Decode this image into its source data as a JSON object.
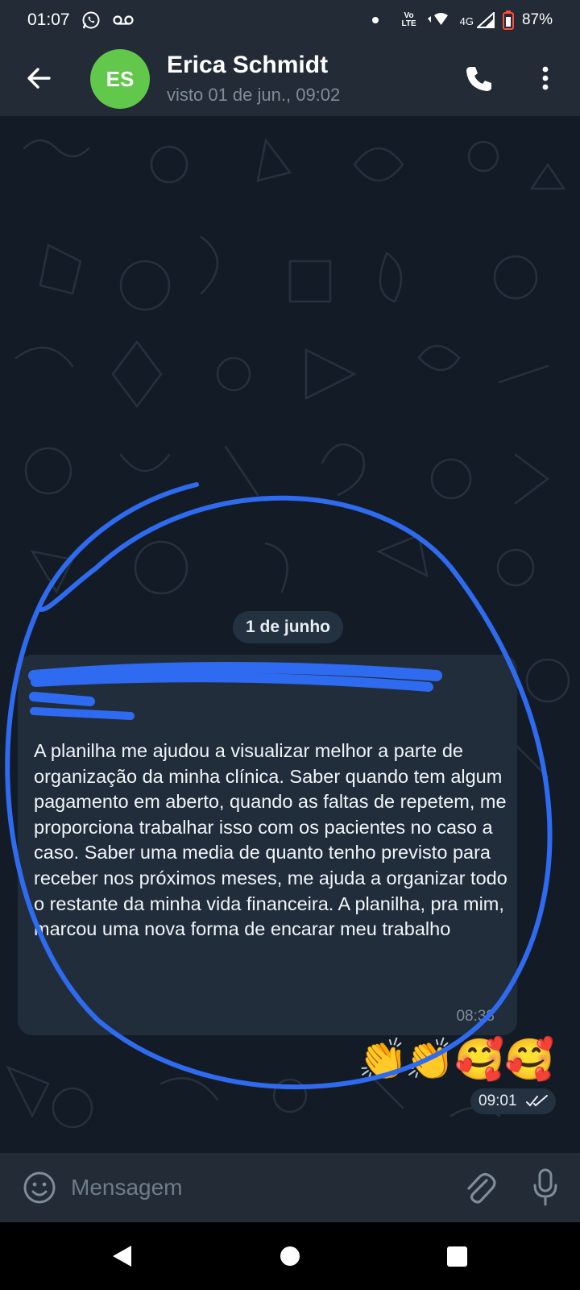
{
  "status_bar": {
    "time": "01:07",
    "lte_top": "Vo",
    "lte_bottom": "LTE",
    "network": "4G",
    "battery": "87%"
  },
  "header": {
    "avatar_initials": "ES",
    "avatar_color": "#62c84c",
    "contact_name": "Erica Schmidt",
    "last_seen": "visto 01 de jun., 09:02"
  },
  "chat": {
    "date_chip": "1 de junho",
    "incoming": {
      "text": "A planilha me ajudou a visualizar melhor a parte de organização da minha clínica. Saber quando tem algum pagamento em aberto, quando as faltas de repetem, me proporciona trabalhar isso com os pacientes no caso a caso. Saber uma media de quanto tenho previsto para receber nos próximos meses, me ajuda a organizar todo o restante da minha vida financeira. A planilha, pra mim, marcou uma nova forma de encarar meu trabalho",
      "time": "08:38"
    },
    "outgoing": {
      "emojis": [
        "👏",
        "👏",
        "🥰",
        "🥰"
      ],
      "time": "09:01",
      "status_icon": "double-check-icon"
    },
    "annotation_color": "#2f6bf0"
  },
  "composer": {
    "placeholder": "Mensagem"
  },
  "icons": [
    "back-arrow-icon",
    "phone-icon",
    "more-vert-icon",
    "emoji-icon",
    "paperclip-icon",
    "microphone-icon",
    "whatsapp-icon",
    "voicemail-icon"
  ]
}
